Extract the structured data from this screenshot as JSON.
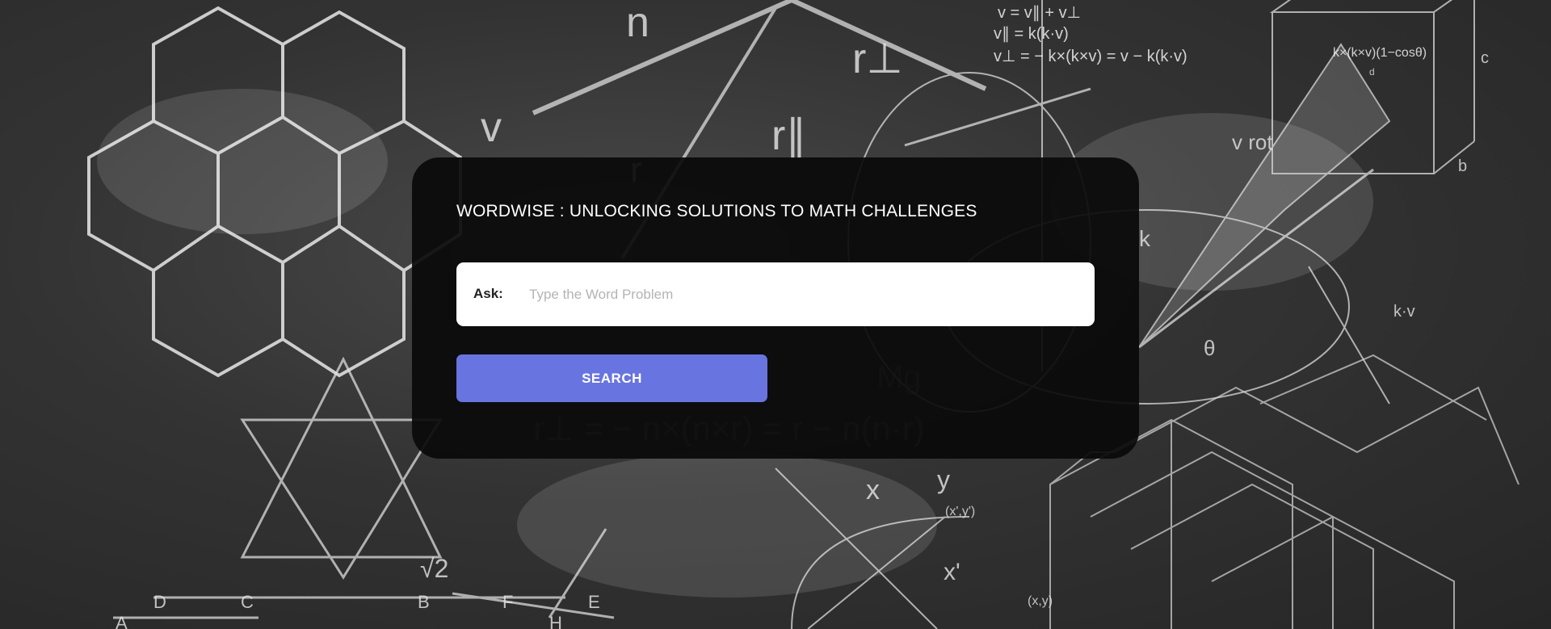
{
  "card": {
    "title": "WORDWISE : UNLOCKING SOLUTIONS TO MATH CHALLENGES"
  },
  "ask": {
    "label": "Ask:",
    "placeholder": "Type the Word Problem",
    "value": ""
  },
  "search_button": {
    "label": "SEARCH"
  },
  "colors": {
    "button": "#6874e0",
    "card": "#0a0a0a",
    "background": "#333333"
  },
  "chalkboard": {
    "formulas": [
      "v = v∥ + v⊥",
      "v∥ = k(k·v)",
      "v⊥ = − k×(k×v) = v − k(k·v)",
      "r⊥ = − n×(n×r) = r − n(n·r)",
      "Mg",
      "k×(k×v)(1−cosθ)"
    ],
    "symbols": [
      "n",
      "v",
      "r",
      "r∥",
      "r⊥",
      "v rot",
      "k",
      "θ",
      "√2",
      "k·v",
      "x",
      "y",
      "x'",
      "(x',y')",
      "(x,y)",
      "c",
      "b",
      "d",
      "D",
      "C",
      "B",
      "F",
      "E",
      "A",
      "H"
    ]
  }
}
